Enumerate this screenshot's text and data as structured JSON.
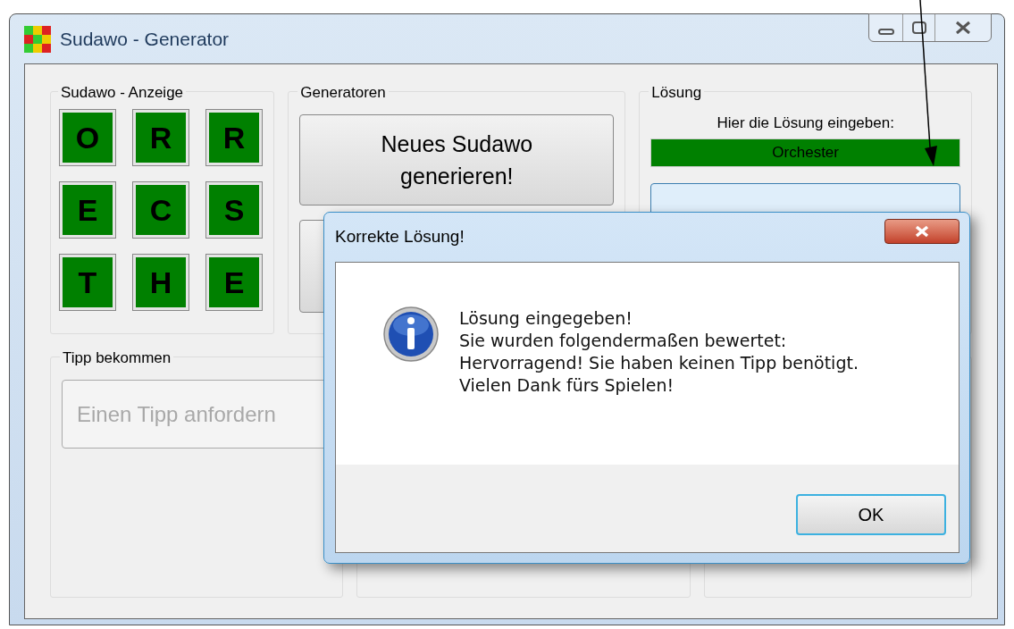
{
  "window": {
    "title": "Sudawo - Generator"
  },
  "display": {
    "title": "Sudawo - Anzeige",
    "tiles": [
      "O",
      "R",
      "R",
      "E",
      "C",
      "S",
      "T",
      "H",
      "E"
    ]
  },
  "generators": {
    "title": "Generatoren",
    "buttons": [
      "Neues Sudawo generieren!"
    ]
  },
  "solution": {
    "title": "Lösung",
    "label": "Hier die Lösung eingeben:",
    "value": "Orchester",
    "correct": true
  },
  "hint": {
    "title": "Tipp bekommen",
    "button": "Einen Tipp anfordern",
    "disabled": true
  },
  "dialog": {
    "title": "Korrekte Lösung!",
    "lines": [
      "Lösung eingegeben!",
      "Sie wurden folgendermaßen bewertet:",
      "Hervorragend! Sie haben keinen Tipp benötigt.",
      "Vielen Dank fürs Spielen!"
    ],
    "button": "OK"
  }
}
